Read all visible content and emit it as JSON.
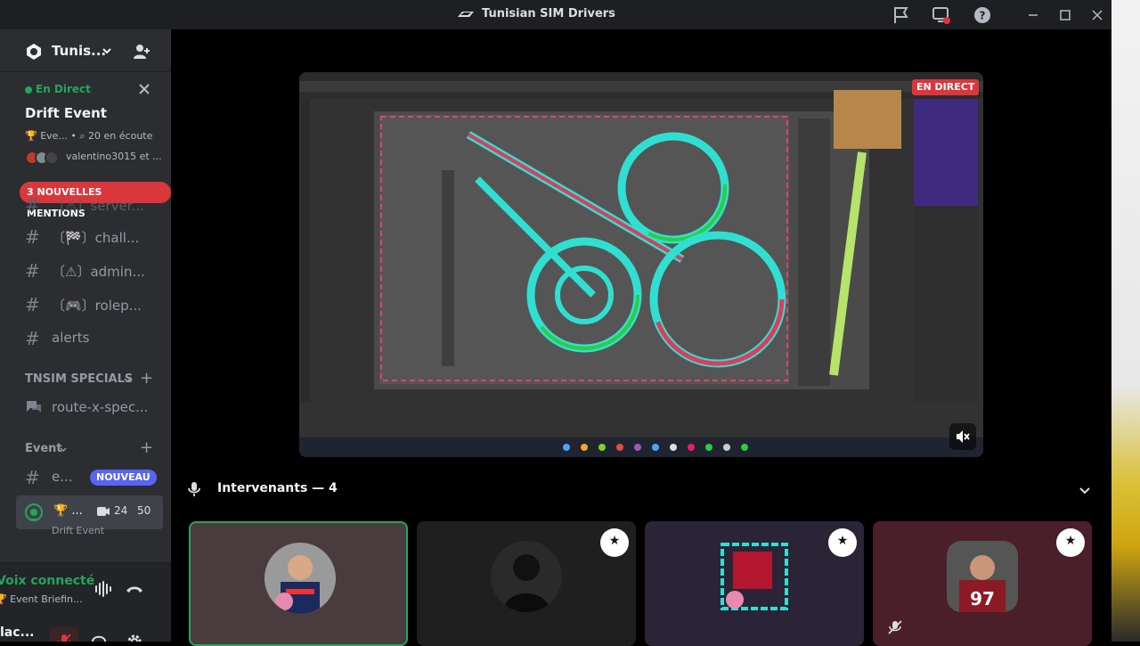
{
  "window": {
    "title": "Tunisian SIM Drivers"
  },
  "guild": {
    "name": "Tunis...",
    "invite_icon": "add-member-icon"
  },
  "live_event": {
    "status": "En Direct",
    "title": "Drift Event",
    "subtitle": "🏆 Eve... • ⌕ 20 en écoute",
    "users": "valentino3015 et ..."
  },
  "mentions_badge": "3 NOUVELLES MENTIONS",
  "channels": [
    {
      "name": "〔⚠〕server...",
      "icon": "text-channel-icon",
      "dim": true
    },
    {
      "name": "〔🏁〕chall...",
      "icon": "text-channel-icon"
    },
    {
      "name": "〔⚠〕admin...",
      "icon": "thread-channel-icon"
    },
    {
      "name": "〔🎮〕rolep...",
      "icon": "thread-channel-icon"
    },
    {
      "name": "alerts",
      "icon": "thread-channel-icon"
    }
  ],
  "categories": {
    "specials": "TNSIM SPECIALS",
    "event": "Event"
  },
  "specials_channel": "route-x-spec...",
  "event_channel": {
    "name": "e...",
    "badge": "NOUVEAU"
  },
  "voice_channel": {
    "name": "🏆 ...",
    "video_count": "24",
    "limit": "50",
    "sublabel": "Drift Event"
  },
  "voice_panel": {
    "status": "Voix connecté",
    "channel": "🏆 Event Briefin..."
  },
  "user_panel": {
    "name": "lac...",
    "status": "visible"
  },
  "stream": {
    "live_badge": "EN DIRECT"
  },
  "speakers": {
    "label": "Intervenants — 4"
  },
  "colors": {
    "live_green": "#23a55a",
    "mention_red": "#da373c",
    "blurple": "#5865f2",
    "sidebar": "#2b2d31"
  }
}
